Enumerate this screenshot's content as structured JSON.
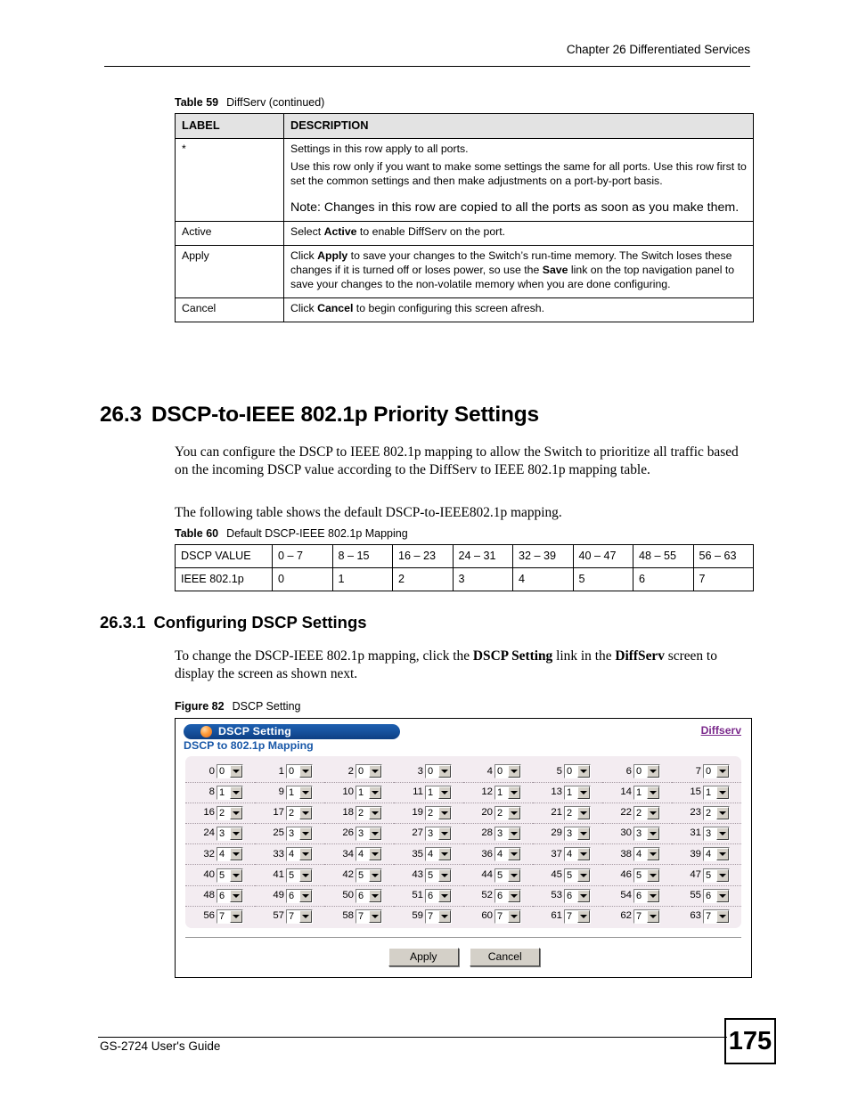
{
  "header": {
    "chapter": "Chapter 26 Differentiated Services"
  },
  "table59": {
    "caption_label": "Table 59",
    "caption_text": "DiffServ (continued)",
    "columns": [
      "LABEL",
      "DESCRIPTION"
    ],
    "rows": [
      {
        "label": "*",
        "paragraphs": [
          "Settings in this row apply to all ports.",
          "Use this row only if you want to make some settings the same for all ports. Use this row first to set the common settings and then make adjustments on a port-by-port basis."
        ],
        "note": "Note: Changes in this row are copied to all the ports as soon as you make them."
      },
      {
        "label": "Active",
        "desc_pre": "Select ",
        "desc_bold": "Active",
        "desc_post": " to enable DiffServ on the port."
      },
      {
        "label": "Apply",
        "desc_a": "Click ",
        "desc_b1": "Apply",
        "desc_c": " to save your changes to the Switch’s run-time memory. The Switch loses these changes if it is turned off or loses power, so use the ",
        "desc_b2": "Save",
        "desc_d": " link on the top navigation panel to save your changes to the non-volatile memory when you are done configuring."
      },
      {
        "label": "Cancel",
        "desc_pre": "Click ",
        "desc_bold": "Cancel",
        "desc_post": " to begin configuring this screen afresh."
      }
    ]
  },
  "section": {
    "number": "26.3",
    "title": "DSCP-to-IEEE 802.1p Priority Settings",
    "para1": "You can configure the DSCP to IEEE 802.1p mapping to allow the Switch to prioritize all traffic based on the incoming DSCP value according to the DiffServ to IEEE 802.1p mapping table.",
    "para2": "The following table shows the default DSCP-to-IEEE802.1p mapping."
  },
  "table60": {
    "caption_label": "Table 60",
    "caption_text": "Default DSCP-IEEE 802.1p Mapping",
    "row1_header": "DSCP VALUE",
    "row2_header": "IEEE 802.1p",
    "dscp_ranges": [
      "0 – 7",
      "8 – 15",
      "16 – 23",
      "24 – 31",
      "32 – 39",
      "40 – 47",
      "48 – 55",
      "56 – 63"
    ],
    "priorities": [
      "0",
      "1",
      "2",
      "3",
      "4",
      "5",
      "6",
      "7"
    ]
  },
  "subsection": {
    "number": "26.3.1",
    "title": "Configuring DSCP Settings",
    "para_a": "To change the DSCP-IEEE 802.1p mapping, click the ",
    "para_b1": "DSCP Setting",
    "para_c": " link in the ",
    "para_b2": "DiffServ",
    "para_d": " screen to display the screen as shown next."
  },
  "figure82": {
    "caption_label": "Figure 82",
    "caption_text": "DSCP Setting",
    "panel_title": "DSCP Setting",
    "panel_subtitle": "DSCP to 802.1p Mapping",
    "link_label": "Diffserv",
    "apply_label": "Apply",
    "cancel_label": "Cancel",
    "accent_blue": "#17539f",
    "accent_orange": "#ff9c3a",
    "link_purple": "#7b2a8c",
    "grid_bg": "#f3ecf1",
    "grid": [
      [
        {
          "i": "0",
          "v": "0"
        },
        {
          "i": "1",
          "v": "0"
        },
        {
          "i": "2",
          "v": "0"
        },
        {
          "i": "3",
          "v": "0"
        },
        {
          "i": "4",
          "v": "0"
        },
        {
          "i": "5",
          "v": "0"
        },
        {
          "i": "6",
          "v": "0"
        },
        {
          "i": "7",
          "v": "0"
        }
      ],
      [
        {
          "i": "8",
          "v": "1"
        },
        {
          "i": "9",
          "v": "1"
        },
        {
          "i": "10",
          "v": "1"
        },
        {
          "i": "11",
          "v": "1"
        },
        {
          "i": "12",
          "v": "1"
        },
        {
          "i": "13",
          "v": "1"
        },
        {
          "i": "14",
          "v": "1"
        },
        {
          "i": "15",
          "v": "1"
        }
      ],
      [
        {
          "i": "16",
          "v": "2"
        },
        {
          "i": "17",
          "v": "2"
        },
        {
          "i": "18",
          "v": "2"
        },
        {
          "i": "19",
          "v": "2"
        },
        {
          "i": "20",
          "v": "2"
        },
        {
          "i": "21",
          "v": "2"
        },
        {
          "i": "22",
          "v": "2"
        },
        {
          "i": "23",
          "v": "2"
        }
      ],
      [
        {
          "i": "24",
          "v": "3"
        },
        {
          "i": "25",
          "v": "3"
        },
        {
          "i": "26",
          "v": "3"
        },
        {
          "i": "27",
          "v": "3"
        },
        {
          "i": "28",
          "v": "3"
        },
        {
          "i": "29",
          "v": "3"
        },
        {
          "i": "30",
          "v": "3"
        },
        {
          "i": "31",
          "v": "3"
        }
      ],
      [
        {
          "i": "32",
          "v": "4"
        },
        {
          "i": "33",
          "v": "4"
        },
        {
          "i": "34",
          "v": "4"
        },
        {
          "i": "35",
          "v": "4"
        },
        {
          "i": "36",
          "v": "4"
        },
        {
          "i": "37",
          "v": "4"
        },
        {
          "i": "38",
          "v": "4"
        },
        {
          "i": "39",
          "v": "4"
        }
      ],
      [
        {
          "i": "40",
          "v": "5"
        },
        {
          "i": "41",
          "v": "5"
        },
        {
          "i": "42",
          "v": "5"
        },
        {
          "i": "43",
          "v": "5"
        },
        {
          "i": "44",
          "v": "5"
        },
        {
          "i": "45",
          "v": "5"
        },
        {
          "i": "46",
          "v": "5"
        },
        {
          "i": "47",
          "v": "5"
        }
      ],
      [
        {
          "i": "48",
          "v": "6"
        },
        {
          "i": "49",
          "v": "6"
        },
        {
          "i": "50",
          "v": "6"
        },
        {
          "i": "51",
          "v": "6"
        },
        {
          "i": "52",
          "v": "6"
        },
        {
          "i": "53",
          "v": "6"
        },
        {
          "i": "54",
          "v": "6"
        },
        {
          "i": "55",
          "v": "6"
        }
      ],
      [
        {
          "i": "56",
          "v": "7"
        },
        {
          "i": "57",
          "v": "7"
        },
        {
          "i": "58",
          "v": "7"
        },
        {
          "i": "59",
          "v": "7"
        },
        {
          "i": "60",
          "v": "7"
        },
        {
          "i": "61",
          "v": "7"
        },
        {
          "i": "62",
          "v": "7"
        },
        {
          "i": "63",
          "v": "7"
        }
      ]
    ]
  },
  "footer": {
    "guide": "GS-2724 User's Guide",
    "page_number": "175"
  }
}
